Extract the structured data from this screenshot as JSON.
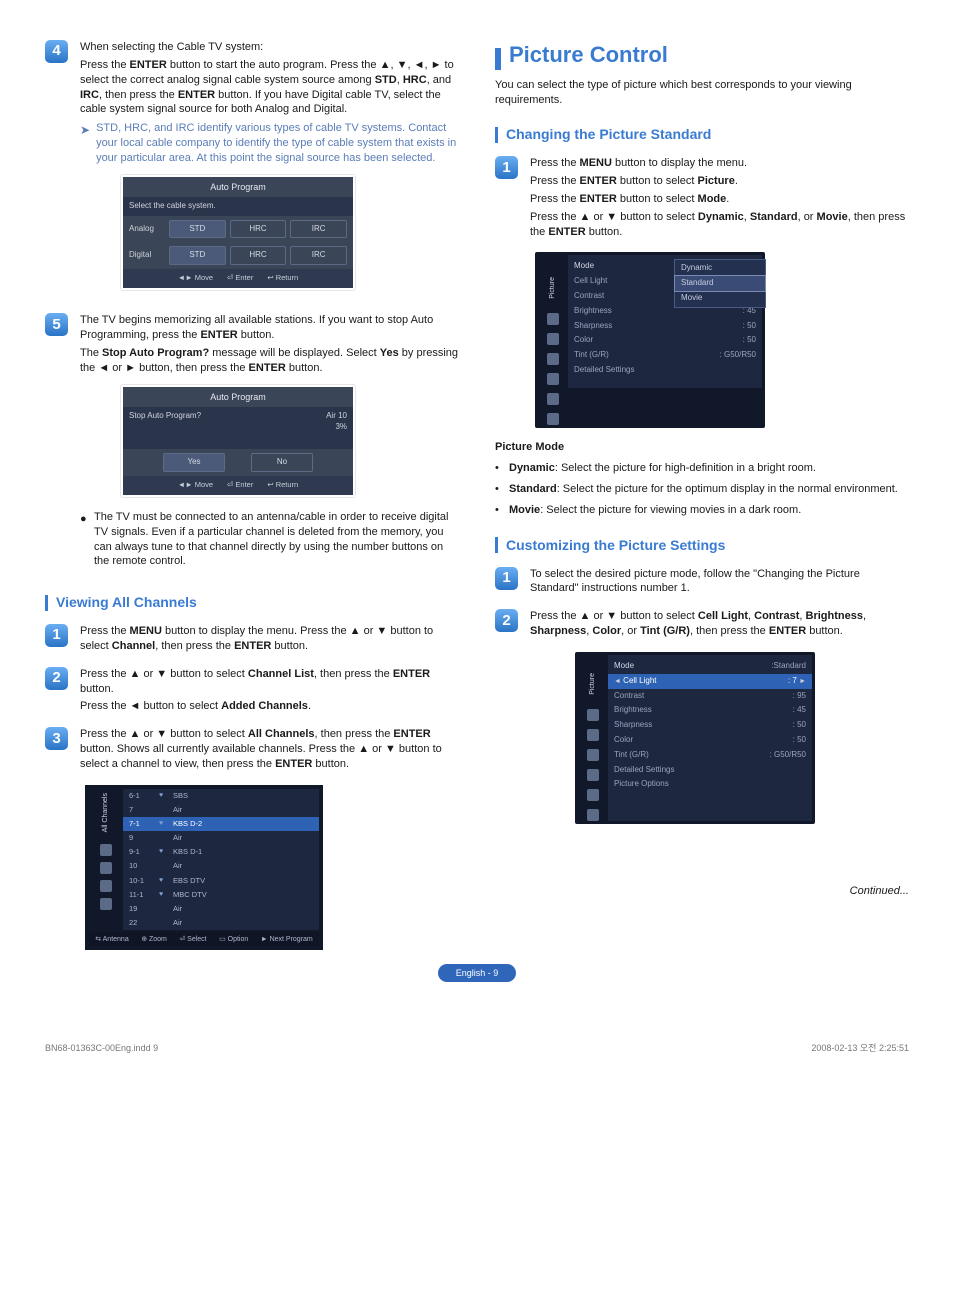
{
  "left": {
    "step4": {
      "num": "4",
      "p1a": "When selecting the Cable TV system:",
      "p1b": "Press the ",
      "p1b2": "ENTER",
      "p1b3": " button to start the auto program. Press the ▲, ▼, ◄, ► to select the correct analog signal cable system source among ",
      "p1c1": "STD",
      "p1c2": ", ",
      "p1c3": "HRC",
      "p1c4": ", and ",
      "p1c5": "IRC",
      "p1c6": ", then press the ",
      "p1c7": "ENTER",
      "p1c8": " button. If you have Digital cable TV, select the cable system signal source for both Analog and Digital.",
      "note": "STD, HRC, and IRC identify various types of cable TV systems. Contact your local cable company to identify the type of cable system that exists in your particular area. At this point the signal source has been selected.",
      "osd": {
        "title": "Auto Program",
        "sub": "Select the cable system.",
        "rowA_label": "Analog",
        "rowD_label": "Digital",
        "opts": [
          "STD",
          "HRC",
          "IRC"
        ],
        "foot": [
          "◄► Move",
          "⏎ Enter",
          "↩ Return"
        ]
      }
    },
    "step5": {
      "num": "5",
      "p1": "The TV begins memorizing all available stations. If you want to stop Auto Programming, press the ",
      "p1b": "ENTER",
      "p1c": " button.",
      "p2a": "The ",
      "p2b": "Stop Auto Program?",
      "p2c": " message will be displayed. Select ",
      "p2d": "Yes",
      "p2e": " by pressing the ◄ or ► button, then press the ",
      "p2f": "ENTER",
      "p2g": " button.",
      "osd": {
        "title": "Auto Program",
        "msg": "Stop Auto Program?",
        "progress": "Air 10\n3%",
        "yes": "Yes",
        "no": "No",
        "foot": [
          "◄► Move",
          "⏎ Enter",
          "↩ Return"
        ]
      },
      "bullet": "The TV must be connected to an antenna/cable in order to receive digital TV signals. Even if a particular channel is deleted from the memory, you can always tune to that channel directly by using the number buttons on the remote control."
    },
    "view": {
      "title": "Viewing All Channels",
      "s1": {
        "num": "1",
        "a": "Press the ",
        "b": "MENU",
        "c": " button to display the menu. Press the ▲ or ▼ button to select ",
        "d": "Channel",
        "e": ", then press the ",
        "f": "ENTER",
        "g": " button."
      },
      "s2": {
        "num": "2",
        "a": "Press the ▲ or ▼ button to select ",
        "b": "Channel List",
        "c": ", then press the ",
        "d": "ENTER",
        "e": " button.",
        "f": "Press the ◄ button to select ",
        "g": "Added Channels",
        "h": "."
      },
      "s3": {
        "num": "3",
        "a": "Press the ▲ or ▼ button to select ",
        "b": "All Channels",
        "c": ", then press the ",
        "d": "ENTER",
        "e": " button. Shows all currently available channels. Press the ▲ or ▼ button to select a channel to view, then press the ",
        "f": "ENTER",
        "g": " button."
      },
      "chanlist": {
        "tab": "All Channels",
        "rows": [
          {
            "num": "6-1",
            "heart": "♥",
            "name": "SBS"
          },
          {
            "num": "7",
            "heart": "",
            "name": "Air"
          },
          {
            "num": "7-1",
            "heart": "♥",
            "name": "KBS D-2"
          },
          {
            "num": "9",
            "heart": "",
            "name": "Air"
          },
          {
            "num": "9-1",
            "heart": "♥",
            "name": "KBS D-1"
          },
          {
            "num": "10",
            "heart": "",
            "name": "Air"
          },
          {
            "num": "10-1",
            "heart": "♥",
            "name": "EBS DTV"
          },
          {
            "num": "11-1",
            "heart": "♥",
            "name": "MBC DTV"
          },
          {
            "num": "19",
            "heart": "",
            "name": "Air"
          },
          {
            "num": "22",
            "heart": "",
            "name": "Air"
          }
        ],
        "foot": [
          "⇆ Antenna",
          "⊕ Zoom",
          "⏎ Select",
          "▭ Option",
          "► Next Program"
        ]
      }
    }
  },
  "right": {
    "title": "Picture Control",
    "intro": "You can select the type of picture which best corresponds to your viewing requirements.",
    "change": {
      "title": "Changing the Picture Standard",
      "s1": {
        "num": "1",
        "l1a": "Press the ",
        "l1b": "MENU",
        "l1c": " button to display the menu.",
        "l2a": "Press the ",
        "l2b": "ENTER",
        "l2c": " button to select ",
        "l2d": "Picture",
        "l2e": ".",
        "l3a": "Press the ",
        "l3b": "ENTER",
        "l3c": " button to select ",
        "l3d": "Mode",
        "l3e": ".",
        "l4a": "Press the ▲ or ▼ button to select ",
        "l4b": "Dynamic",
        "l4c": ", ",
        "l4d": "Standard",
        "l4e": ", or ",
        "l4f": "Movie",
        "l4g": ", then press the ",
        "l4h": "ENTER",
        "l4i": " button."
      },
      "osd": {
        "sidebar": "Picture",
        "lines": [
          {
            "k": "Mode",
            "v": ""
          },
          {
            "k": "Cell Light",
            "v": ""
          },
          {
            "k": "Contrast",
            "v": ""
          },
          {
            "k": "Brightness",
            "v": ": 45"
          },
          {
            "k": "Sharpness",
            "v": ": 50"
          },
          {
            "k": "Color",
            "v": ": 50"
          },
          {
            "k": "Tint (G/R)",
            "v": ": G50/R50"
          },
          {
            "k": "Detailed Settings",
            "v": ""
          }
        ],
        "submenu": [
          "Dynamic",
          "Standard",
          "Movie"
        ]
      },
      "modesTitle": "Picture Mode",
      "modes": [
        {
          "b": "Dynamic",
          "t": ": Select the picture for high-definition in a bright room."
        },
        {
          "b": "Standard",
          "t": ": Select the picture for the optimum display in the normal environment."
        },
        {
          "b": "Movie",
          "t": ": Select the picture for viewing movies in a dark room."
        }
      ]
    },
    "custom": {
      "title": "Customizing the Picture Settings",
      "s1": {
        "num": "1",
        "t": "To select the desired picture mode, follow the \"Changing the Picture Standard\" instructions number 1."
      },
      "s2": {
        "num": "2",
        "a": "Press the ▲ or ▼ button to select ",
        "b": "Cell Light",
        "c": ", ",
        "d": "Contrast",
        "e": ", ",
        "f": "Brightness",
        "g": ", ",
        "h": "Sharpness",
        "i": ", ",
        "j": "Color",
        "k": ", or ",
        "l": "Tint (G/R)",
        "m": ", then press the ",
        "n": "ENTER",
        "o": " button."
      },
      "osd": {
        "sidebar": "Picture",
        "lines": [
          {
            "k": "Mode",
            "v": ":Standard"
          },
          {
            "k": "Cell Light",
            "v": ": 7"
          },
          {
            "k": "Contrast",
            "v": ": 95"
          },
          {
            "k": "Brightness",
            "v": ": 45"
          },
          {
            "k": "Sharpness",
            "v": ": 50"
          },
          {
            "k": "Color",
            "v": ": 50"
          },
          {
            "k": "Tint (G/R)",
            "v": ": G50/R50"
          },
          {
            "k": "Detailed Settings",
            "v": ""
          },
          {
            "k": "Picture Options",
            "v": ""
          }
        ]
      }
    },
    "continued": "Continued..."
  },
  "pager": "English - 9",
  "docfooter": {
    "left": "BN68-01363C-00Eng.indd   9",
    "right": "2008-02-13   오전 2:25:51"
  }
}
